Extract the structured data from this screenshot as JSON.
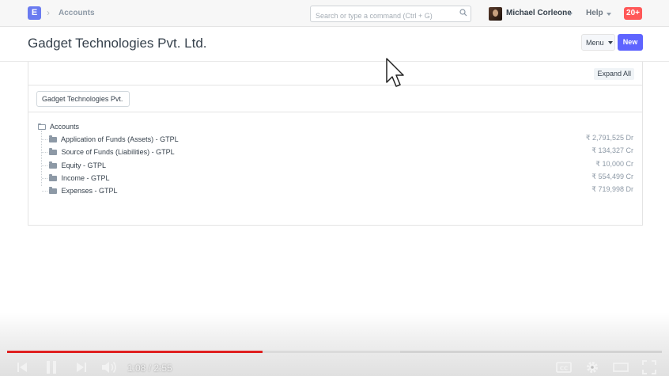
{
  "navbar": {
    "logo_letter": "E",
    "breadcrumb": "Accounts",
    "search_placeholder": "Search or type a command (Ctrl + G)",
    "user_name": "Michael Corleone",
    "help_label": "Help",
    "notification_count": "20+"
  },
  "page": {
    "title": "Gadget Technologies Pvt. Ltd.",
    "menu_label": "Menu",
    "new_label": "New"
  },
  "panel": {
    "expand_all_label": "Expand All",
    "company_filter": "Gadget Technologies Pvt.",
    "tree": {
      "root_label": "Accounts",
      "items": [
        {
          "label": "Application of Funds (Assets) - GTPL",
          "balance": "₹ 2,791,525 Dr"
        },
        {
          "label": "Source of Funds (Liabilities) - GTPL",
          "balance": "₹ 134,327 Cr"
        },
        {
          "label": "Equity - GTPL",
          "balance": "₹ 10,000 Cr"
        },
        {
          "label": "Income - GTPL",
          "balance": "₹ 554,499 Cr"
        },
        {
          "label": "Expenses - GTPL",
          "balance": "₹ 719,998 Dr"
        }
      ]
    }
  },
  "player": {
    "time_display": "1:08 / 2:55",
    "progress_fraction": 0.39,
    "buffered_fraction": 0.6,
    "accent_color": "#e02020"
  },
  "colors": {
    "primary_button": "#5e64ff",
    "notification_badge": "#ff5858",
    "logo_bg": "#6a7bf0"
  }
}
